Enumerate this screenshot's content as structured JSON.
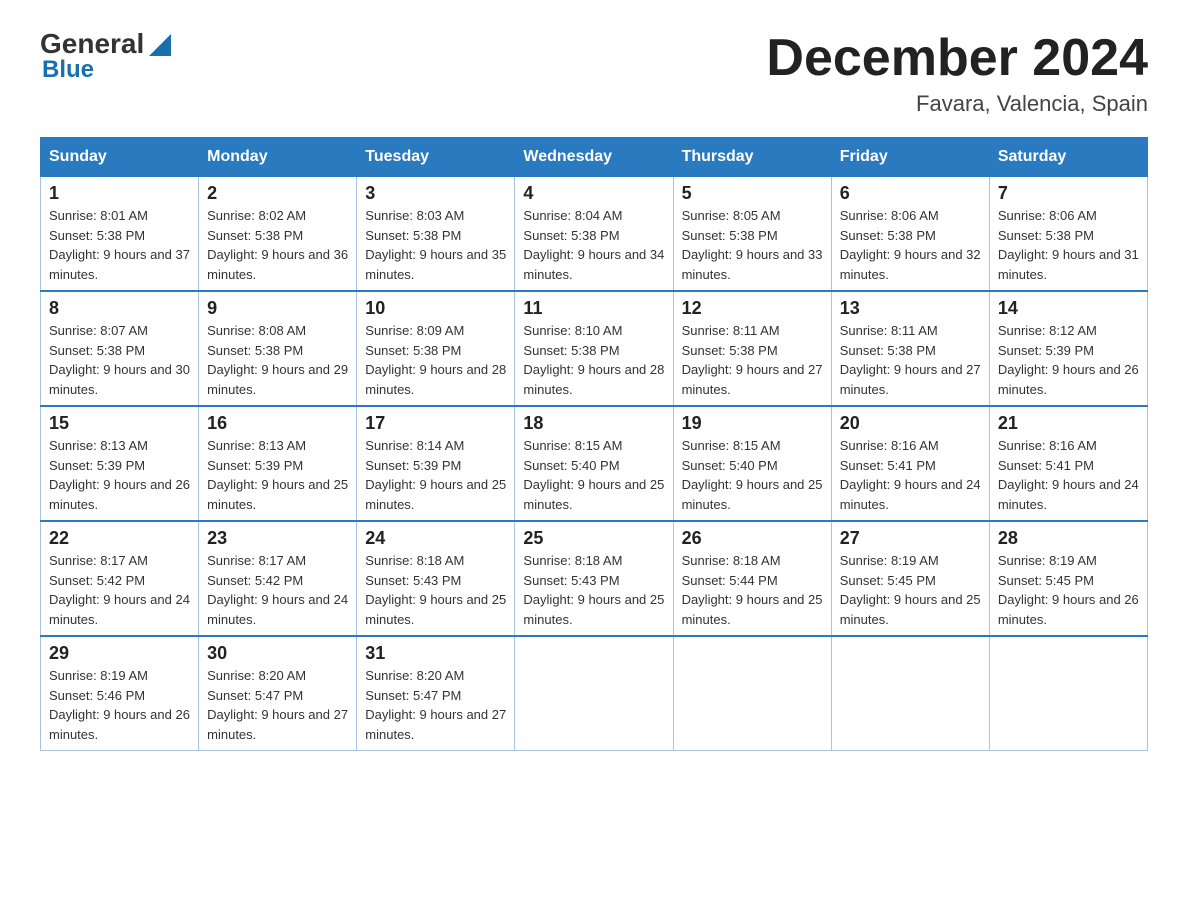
{
  "header": {
    "logo_line1": "General",
    "logo_line2": "Blue",
    "month_title": "December 2024",
    "location": "Favara, Valencia, Spain"
  },
  "weekdays": [
    "Sunday",
    "Monday",
    "Tuesday",
    "Wednesday",
    "Thursday",
    "Friday",
    "Saturday"
  ],
  "weeks": [
    [
      {
        "day": "1",
        "sunrise": "Sunrise: 8:01 AM",
        "sunset": "Sunset: 5:38 PM",
        "daylight": "Daylight: 9 hours and 37 minutes."
      },
      {
        "day": "2",
        "sunrise": "Sunrise: 8:02 AM",
        "sunset": "Sunset: 5:38 PM",
        "daylight": "Daylight: 9 hours and 36 minutes."
      },
      {
        "day": "3",
        "sunrise": "Sunrise: 8:03 AM",
        "sunset": "Sunset: 5:38 PM",
        "daylight": "Daylight: 9 hours and 35 minutes."
      },
      {
        "day": "4",
        "sunrise": "Sunrise: 8:04 AM",
        "sunset": "Sunset: 5:38 PM",
        "daylight": "Daylight: 9 hours and 34 minutes."
      },
      {
        "day": "5",
        "sunrise": "Sunrise: 8:05 AM",
        "sunset": "Sunset: 5:38 PM",
        "daylight": "Daylight: 9 hours and 33 minutes."
      },
      {
        "day": "6",
        "sunrise": "Sunrise: 8:06 AM",
        "sunset": "Sunset: 5:38 PM",
        "daylight": "Daylight: 9 hours and 32 minutes."
      },
      {
        "day": "7",
        "sunrise": "Sunrise: 8:06 AM",
        "sunset": "Sunset: 5:38 PM",
        "daylight": "Daylight: 9 hours and 31 minutes."
      }
    ],
    [
      {
        "day": "8",
        "sunrise": "Sunrise: 8:07 AM",
        "sunset": "Sunset: 5:38 PM",
        "daylight": "Daylight: 9 hours and 30 minutes."
      },
      {
        "day": "9",
        "sunrise": "Sunrise: 8:08 AM",
        "sunset": "Sunset: 5:38 PM",
        "daylight": "Daylight: 9 hours and 29 minutes."
      },
      {
        "day": "10",
        "sunrise": "Sunrise: 8:09 AM",
        "sunset": "Sunset: 5:38 PM",
        "daylight": "Daylight: 9 hours and 28 minutes."
      },
      {
        "day": "11",
        "sunrise": "Sunrise: 8:10 AM",
        "sunset": "Sunset: 5:38 PM",
        "daylight": "Daylight: 9 hours and 28 minutes."
      },
      {
        "day": "12",
        "sunrise": "Sunrise: 8:11 AM",
        "sunset": "Sunset: 5:38 PM",
        "daylight": "Daylight: 9 hours and 27 minutes."
      },
      {
        "day": "13",
        "sunrise": "Sunrise: 8:11 AM",
        "sunset": "Sunset: 5:38 PM",
        "daylight": "Daylight: 9 hours and 27 minutes."
      },
      {
        "day": "14",
        "sunrise": "Sunrise: 8:12 AM",
        "sunset": "Sunset: 5:39 PM",
        "daylight": "Daylight: 9 hours and 26 minutes."
      }
    ],
    [
      {
        "day": "15",
        "sunrise": "Sunrise: 8:13 AM",
        "sunset": "Sunset: 5:39 PM",
        "daylight": "Daylight: 9 hours and 26 minutes."
      },
      {
        "day": "16",
        "sunrise": "Sunrise: 8:13 AM",
        "sunset": "Sunset: 5:39 PM",
        "daylight": "Daylight: 9 hours and 25 minutes."
      },
      {
        "day": "17",
        "sunrise": "Sunrise: 8:14 AM",
        "sunset": "Sunset: 5:39 PM",
        "daylight": "Daylight: 9 hours and 25 minutes."
      },
      {
        "day": "18",
        "sunrise": "Sunrise: 8:15 AM",
        "sunset": "Sunset: 5:40 PM",
        "daylight": "Daylight: 9 hours and 25 minutes."
      },
      {
        "day": "19",
        "sunrise": "Sunrise: 8:15 AM",
        "sunset": "Sunset: 5:40 PM",
        "daylight": "Daylight: 9 hours and 25 minutes."
      },
      {
        "day": "20",
        "sunrise": "Sunrise: 8:16 AM",
        "sunset": "Sunset: 5:41 PM",
        "daylight": "Daylight: 9 hours and 24 minutes."
      },
      {
        "day": "21",
        "sunrise": "Sunrise: 8:16 AM",
        "sunset": "Sunset: 5:41 PM",
        "daylight": "Daylight: 9 hours and 24 minutes."
      }
    ],
    [
      {
        "day": "22",
        "sunrise": "Sunrise: 8:17 AM",
        "sunset": "Sunset: 5:42 PM",
        "daylight": "Daylight: 9 hours and 24 minutes."
      },
      {
        "day": "23",
        "sunrise": "Sunrise: 8:17 AM",
        "sunset": "Sunset: 5:42 PM",
        "daylight": "Daylight: 9 hours and 24 minutes."
      },
      {
        "day": "24",
        "sunrise": "Sunrise: 8:18 AM",
        "sunset": "Sunset: 5:43 PM",
        "daylight": "Daylight: 9 hours and 25 minutes."
      },
      {
        "day": "25",
        "sunrise": "Sunrise: 8:18 AM",
        "sunset": "Sunset: 5:43 PM",
        "daylight": "Daylight: 9 hours and 25 minutes."
      },
      {
        "day": "26",
        "sunrise": "Sunrise: 8:18 AM",
        "sunset": "Sunset: 5:44 PM",
        "daylight": "Daylight: 9 hours and 25 minutes."
      },
      {
        "day": "27",
        "sunrise": "Sunrise: 8:19 AM",
        "sunset": "Sunset: 5:45 PM",
        "daylight": "Daylight: 9 hours and 25 minutes."
      },
      {
        "day": "28",
        "sunrise": "Sunrise: 8:19 AM",
        "sunset": "Sunset: 5:45 PM",
        "daylight": "Daylight: 9 hours and 26 minutes."
      }
    ],
    [
      {
        "day": "29",
        "sunrise": "Sunrise: 8:19 AM",
        "sunset": "Sunset: 5:46 PM",
        "daylight": "Daylight: 9 hours and 26 minutes."
      },
      {
        "day": "30",
        "sunrise": "Sunrise: 8:20 AM",
        "sunset": "Sunset: 5:47 PM",
        "daylight": "Daylight: 9 hours and 27 minutes."
      },
      {
        "day": "31",
        "sunrise": "Sunrise: 8:20 AM",
        "sunset": "Sunset: 5:47 PM",
        "daylight": "Daylight: 9 hours and 27 minutes."
      },
      null,
      null,
      null,
      null
    ]
  ]
}
